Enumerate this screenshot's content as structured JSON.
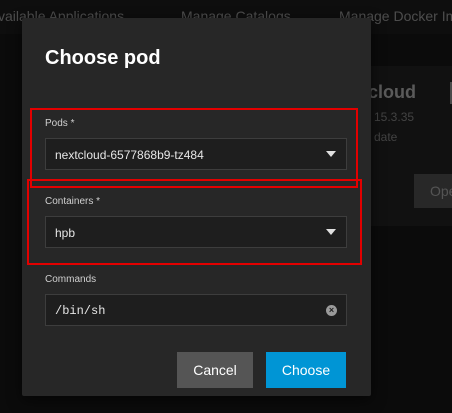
{
  "background": {
    "tabs": [
      "vailable Applications",
      "Manage Catalogs",
      "Manage Docker Im"
    ],
    "card": {
      "title": "cloud",
      "version": "15.3.35",
      "date": "date",
      "button_label": "Ope"
    }
  },
  "dialog": {
    "title": "Choose pod",
    "pods": {
      "label": "Pods *",
      "value": "nextcloud-6577868b9-tz484"
    },
    "containers": {
      "label": "Containers *",
      "value": "hpb"
    },
    "commands": {
      "label": "Commands",
      "value": "/bin/sh"
    },
    "cancel_label": "Cancel",
    "choose_label": "Choose"
  },
  "colors": {
    "dialog_bg": "#272727",
    "primary": "#0095d5",
    "secondary": "#555555",
    "highlight": "#e30000"
  }
}
